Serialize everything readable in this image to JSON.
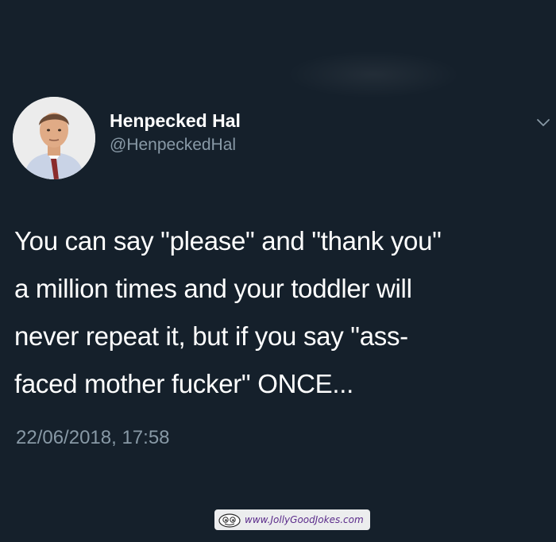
{
  "tweet": {
    "author": {
      "display_name": "Henpecked Hal",
      "handle": "@HenpeckedHal",
      "avatar_icon": "profile-photo"
    },
    "menu_icon": "chevron-down-icon",
    "text_lines": [
      "You can say \"please\" and \"thank you\"",
      "a million times and your toddler will",
      "never repeat it, but if you say \"ass-",
      "faced mother fucker\" ONCE..."
    ],
    "timestamp": "22/06/2018, 17:58"
  },
  "watermark": {
    "text": "www.JollyGoodJokes.com",
    "logo_icon": "mascot-logo"
  },
  "colors": {
    "background": "#15202b",
    "primary_text": "#ffffff",
    "secondary_text": "#8899a6"
  }
}
